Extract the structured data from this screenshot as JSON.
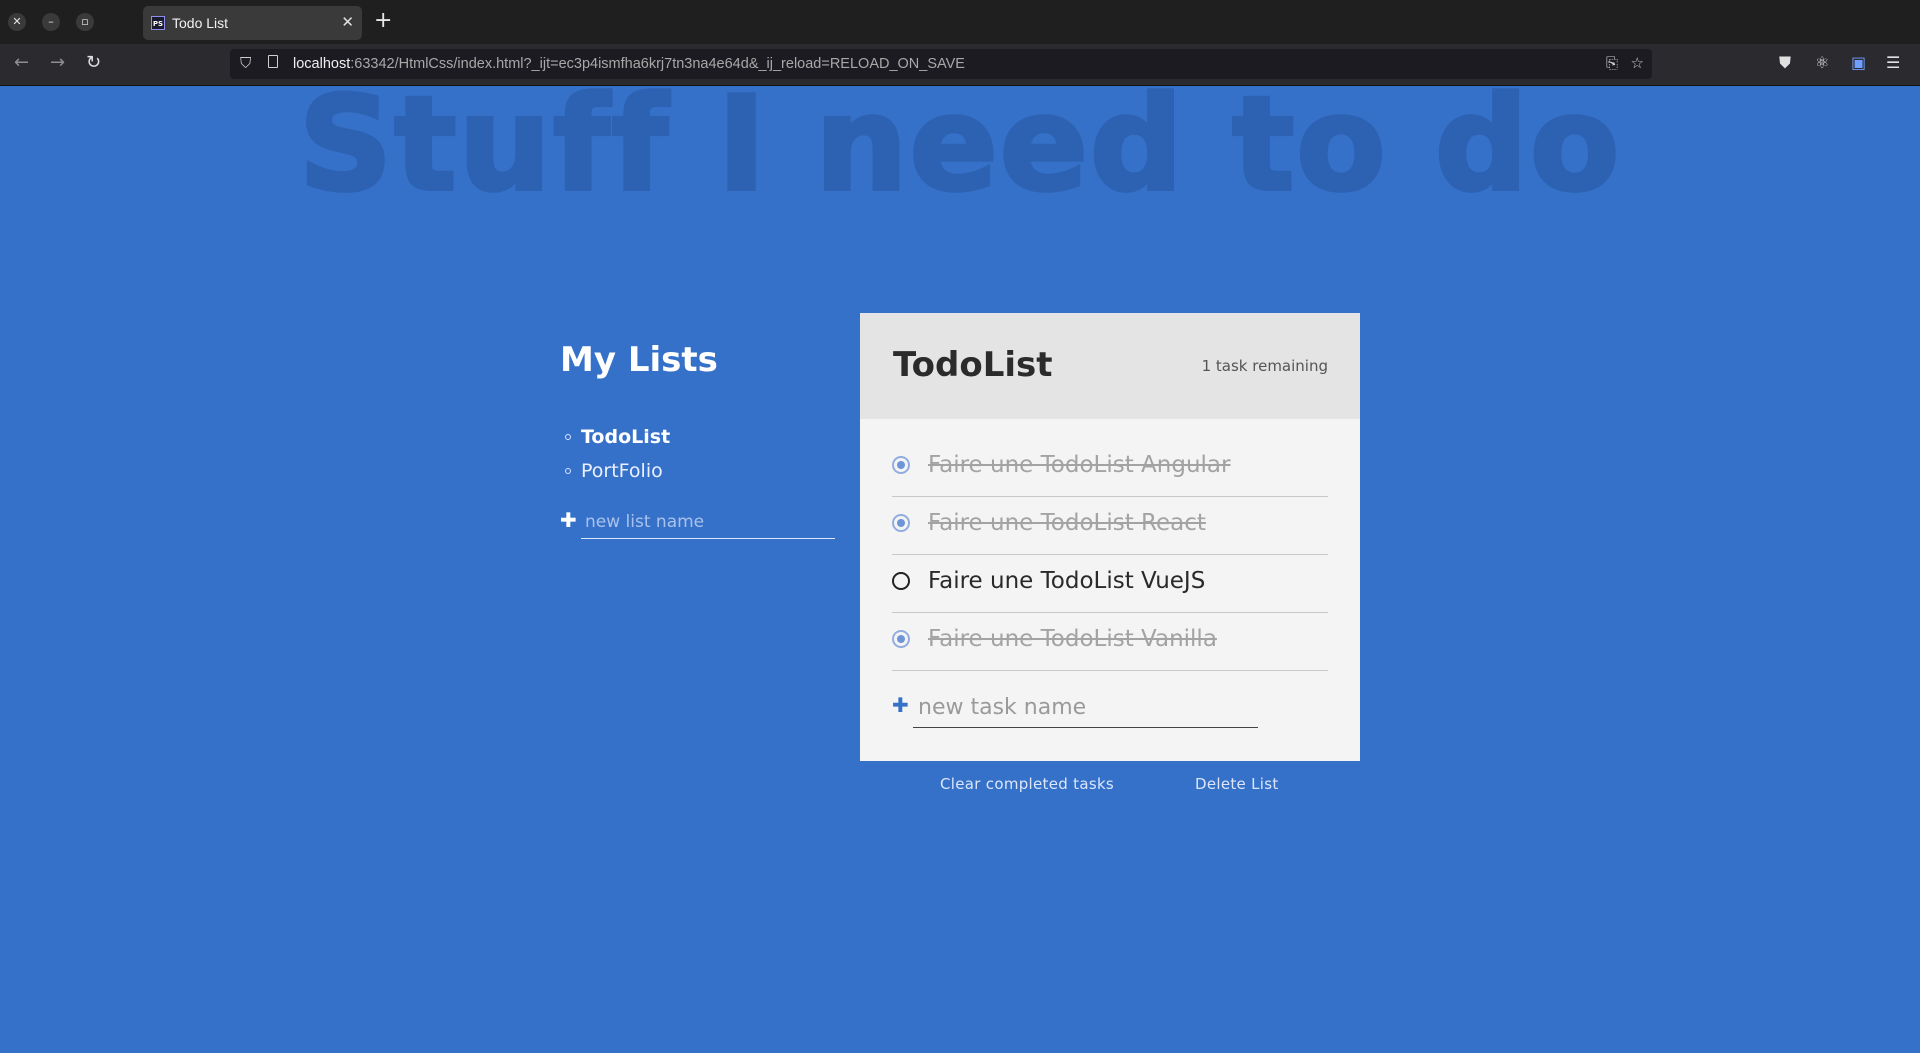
{
  "browser": {
    "tab_title": "Todo List",
    "tab_favicon": "PS",
    "url_host": "localhost",
    "url_rest": ":63342/HtmlCss/index.html?_ijt=ec3p4ismfha6krj7tn3na4e64d&_ij_reload=RELOAD_ON_SAVE"
  },
  "page": {
    "background_title": "Stuff I need to do",
    "accent_color": "#3671c9"
  },
  "lists": {
    "title": "My Lists",
    "items": [
      {
        "label": "TodoList",
        "active": true
      },
      {
        "label": "PortFolio",
        "active": false
      }
    ],
    "new_list_placeholder": "new list name"
  },
  "todo": {
    "title": "TodoList",
    "remaining": "1 task remaining",
    "tasks": [
      {
        "label": "Faire une TodoList Angular",
        "done": true
      },
      {
        "label": "Faire une TodoList React",
        "done": true
      },
      {
        "label": "Faire une TodoList VueJS",
        "done": false
      },
      {
        "label": "Faire une TodoList Vanilla",
        "done": true
      }
    ],
    "new_task_placeholder": "new task name",
    "clear_label": "Clear completed tasks",
    "delete_label": "Delete List"
  }
}
